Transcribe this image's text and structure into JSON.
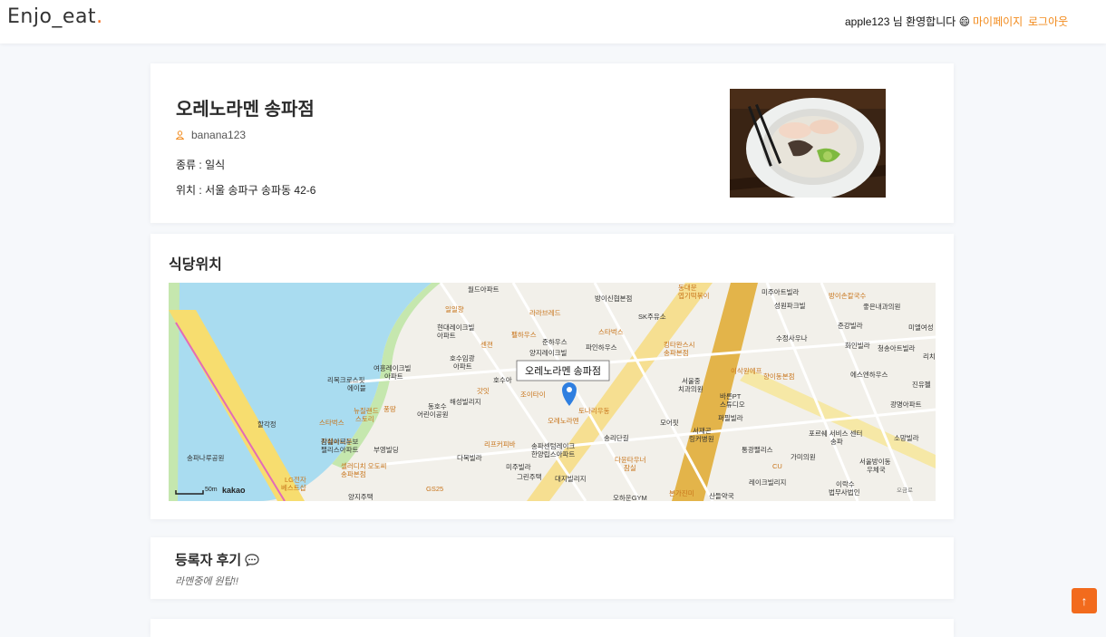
{
  "header": {
    "logo_text": "Enjo_eat",
    "logo_dot": ".",
    "welcome": "apple123 님 환영합니다 😄",
    "mypage_label": "마이페이지",
    "logout_label": "로그아웃"
  },
  "restaurant": {
    "name": "오레노라멘 송파점",
    "writer": "banana123",
    "category": "종류 : 일식",
    "location": "위치 : 서울 송파구 송파동 42-6"
  },
  "map_section": {
    "title": "식당위치",
    "marker_label": "오레노라멘 송파점",
    "scale_label": "50m",
    "kakao_label": "kakao",
    "places": [
      "월드아파트",
      "일일향",
      "현대레이크빌",
      "아파트",
      "라라브레드",
      "펠하우스",
      "방이신협본점",
      "SK주유소",
      "동대문엽기떡볶이",
      "미주아트빌라",
      "성원파크빌",
      "방이손칼국수",
      "좋은내과의원",
      "준강빌라",
      "미엘여성",
      "호수임광",
      "아파트",
      "센젼",
      "양지레이크빌",
      "파인하우스",
      "스타벅스",
      "킹타완스시",
      "송파본점",
      "수정사우나",
      "화인빌라",
      "청송아트빌라",
      "리치",
      "리복크로스핏",
      "에이블",
      "여흥레이크빌",
      "아파트",
      "호수아",
      "갓잇",
      "오레노라멘",
      "이삭원에프",
      "향이동본점",
      "에스엔하우스",
      "진유폘",
      "뉴질랜드",
      "스토리",
      "풍땅",
      "동호수",
      "어린이공원",
      "해성빌리지",
      "조이타이",
      "토나리우동",
      "서울중",
      "치과의원",
      "바른PT",
      "스튜디오",
      "퍼필빌라",
      "광명아파트",
      "잠실아르누보",
      "팰리스아파트",
      "부영빌딩",
      "리프커피바",
      "송파센텀레이크",
      "한양립스아파트",
      "송리단길",
      "모어핏",
      "서재곤",
      "링커병원",
      "포르쉐 서비스 센터",
      "송파",
      "소망빌라",
      "가미의원",
      "LG전자",
      "베스트샵",
      "셀러디치 오도씨",
      "송파본점",
      "다복빌라",
      "미주빌라",
      "그린주택",
      "대지빌리지",
      "다윤타우너",
      "잠실",
      "통광팰리스",
      "CU",
      "서울방이동",
      "우체국",
      "레이크빌리지",
      "이락수",
      "법무사법인",
      "양지주택",
      "GS25",
      "본가진미",
      "오하운GYM",
      "산들약국",
      "송파나루공원",
      "카페시니폰",
      "스타벅스",
      "할각정",
      "오금로"
    ]
  },
  "review_section": {
    "title": "등록자 후기",
    "text": "라멘중에 원탑!!"
  },
  "scroll_top": "↑"
}
